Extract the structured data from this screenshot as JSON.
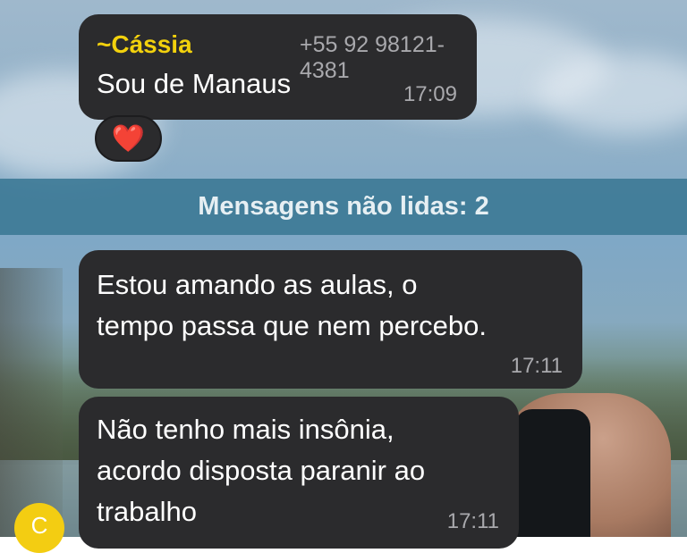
{
  "messages": [
    {
      "sender_name": "~Cássia",
      "sender_phone": "+55 92 98121-4381",
      "text": "Sou de Manaus",
      "time": "17:09",
      "reaction": "❤️"
    },
    {
      "line1": "Estou amando as aulas, o",
      "line2": "tempo passa que nem percebo.",
      "time": "17:11"
    },
    {
      "line1": "Não tenho mais insônia,",
      "line2": "acordo disposta paranir ao",
      "line3": "trabalho",
      "time": "17:11"
    }
  ],
  "unread_banner": "Mensagens não lidas: 2",
  "avatar_initial": "C",
  "colors": {
    "bubble": "#2b2b2d",
    "sender_name": "#f2d10d",
    "unread_banner": "#3a7894",
    "avatar": "#f3cd12"
  }
}
